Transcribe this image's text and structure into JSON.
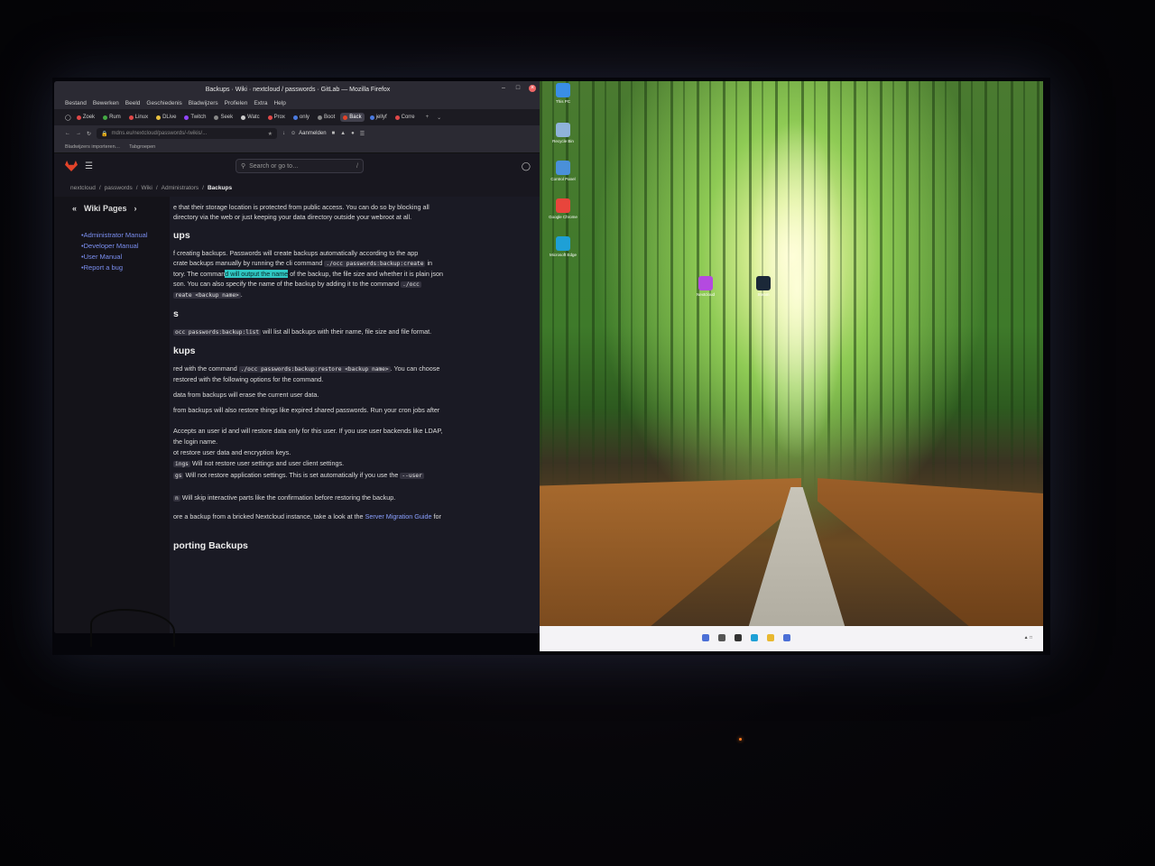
{
  "browser": {
    "title": "Backups · Wiki · nextcloud / passwords · GitLab — Mozilla Firefox",
    "menu": [
      "Bestand",
      "Bewerken",
      "Beeld",
      "Geschiedenis",
      "Bladwijzers",
      "Profielen",
      "Extra",
      "Help"
    ],
    "tabs": [
      {
        "label": "Zoek",
        "color": "#e04848"
      },
      {
        "label": "Rum",
        "color": "#44aa44"
      },
      {
        "label": "Linux",
        "color": "#e04848"
      },
      {
        "label": "DLive",
        "color": "#e8c040"
      },
      {
        "label": "Twitch",
        "color": "#9146ff"
      },
      {
        "label": "Seek",
        "color": "#888888"
      },
      {
        "label": "Watc",
        "color": "#cccccc"
      },
      {
        "label": "Prox",
        "color": "#e04848"
      },
      {
        "label": "only",
        "color": "#4a7ae0"
      },
      {
        "label": "Boot",
        "color": "#888888"
      },
      {
        "label": "Back",
        "color": "#e24329",
        "active": true
      },
      {
        "label": "jellyf",
        "color": "#4a7ae0"
      },
      {
        "label": "Corre",
        "color": "#e04848"
      }
    ],
    "url": "mdns.eu/nextcloud/passwords/-/wikis/...",
    "signin_label": "Aanmelden",
    "bookmarks": [
      "Bladwijzers importeren…",
      "Tabgroepen"
    ]
  },
  "gitlab": {
    "search_placeholder": "Search or go to…",
    "search_shortcut": "/",
    "breadcrumbs": [
      "nextcloud",
      "passwords",
      "Wiki",
      "Administrators",
      "Backups"
    ],
    "sidebar_title": "Wiki Pages",
    "sidebar_items": [
      "Administrator Manual",
      "Developer Manual",
      "User Manual",
      "Report a bug"
    ]
  },
  "content": {
    "intro_1": "e that their storage location is protected from public access. You can do so by blocking all",
    "intro_2": "directory via the web or just keeping your data directory outside your webroot at all.",
    "h_create": "ups",
    "create_p1a": "f creating backups. Passwords will create backups automatically according to the app",
    "create_p1b": "crate backups manually by running the cli command",
    "create_code1": "./occ passwords:backup:create",
    "create_p1c": "in",
    "create_p2a": "tory. The comman",
    "create_highlight": "d will output the name",
    "create_p2b": "of the backup, the file size and whether it is plain json",
    "create_p3a": "son. You can also specify the name of the backup by adding it to the command",
    "create_code2": "./occ",
    "create_code3": "reate <backup name>",
    "create_p3end": ".",
    "h_list": "s",
    "list_code": "occ passwords:backup:list",
    "list_text": "will list all backups with their name, file size and file format.",
    "h_restore": "kups",
    "restore_p1a": "red with the command",
    "restore_code": "./occ passwords:backup:restore <backup name>",
    "restore_p1b": ". You can choose",
    "restore_p2": "restored with the following options for the command.",
    "restore_warn1": "data from backups will erase the current user data.",
    "restore_warn2": "from backups will also restore things like expired shared passwords. Run your cron jobs after",
    "opt_user_a": "Accepts an user id and will restore data only for this user. If you use user backends like LDAP,",
    "opt_user_b": "the login name.",
    "opt_nodata": "ot restore user data and encryption keys.",
    "opt_settings_code": "ings",
    "opt_settings": "Will not restore user settings and user client settings.",
    "opt_app_code": "gs",
    "opt_app": "Will not restore application settings. This is set automatically if you use the",
    "opt_app_user_code": "--user",
    "opt_noint_code": "n",
    "opt_noint": "Will skip interactive parts like the confirmation before restoring the backup.",
    "bricked_a": "ore a backup from a bricked Nextcloud instance, take a look at the",
    "bricked_link": "Server Migration Guide",
    "bricked_b": "for",
    "h_export": "porting Backups"
  },
  "desktop": {
    "icons": [
      {
        "label": "This PC",
        "color": "#3a8ee6"
      },
      {
        "label": "Recycle Bin",
        "color": "#8fb3d9"
      },
      {
        "label": "Control Panel",
        "color": "#4a90d9"
      },
      {
        "label": "Google Chrome",
        "color": "#e8453c"
      },
      {
        "label": "Microsoft Edge",
        "color": "#1ea0d6"
      },
      {
        "label": "Nextcloud",
        "color": "#b44ae0"
      },
      {
        "label": "Steam",
        "color": "#1b2838"
      }
    ]
  }
}
